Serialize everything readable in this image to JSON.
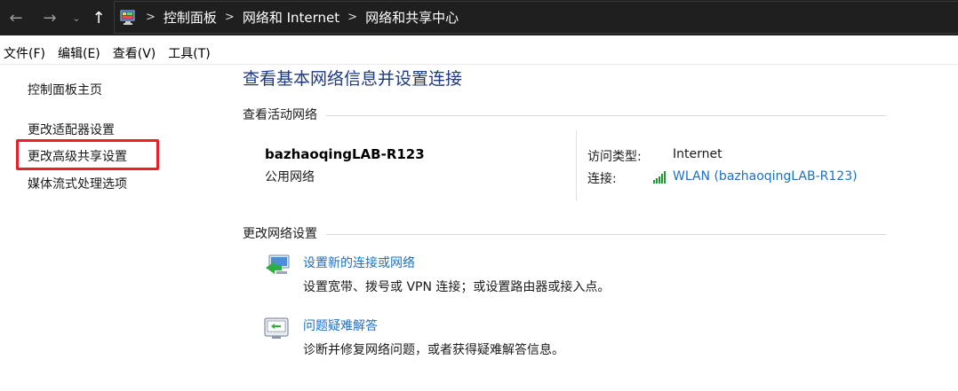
{
  "address_bar": {
    "back_glyph": "←",
    "forward_glyph": "→",
    "recent_glyph": "⌄",
    "up_glyph": "↑",
    "location_icon": "control-panel-icon",
    "separator": ">",
    "breadcrumbs": [
      "控制面板",
      "网络和 Internet",
      "网络和共享中心"
    ]
  },
  "menu": [
    "文件(F)",
    "编辑(E)",
    "查看(V)",
    "工具(T)"
  ],
  "left_nav": {
    "home": "控制面板主页",
    "items": [
      "更改适配器设置",
      "更改高级共享设置",
      "媒体流式处理选项"
    ],
    "highlighted_index": 1,
    "highlight_color": "#e8202a"
  },
  "main": {
    "title": "查看基本网络信息并设置连接",
    "active_networks": {
      "section_title": "查看活动网络",
      "network_name": "bazhaoqingLAB-R123",
      "network_kind": "公用网络",
      "access_type_label": "访问类型:",
      "access_type_value": "Internet",
      "connection_label": "连接:",
      "connection_icon": "wifi-signal-icon",
      "connection_value": "WLAN (bazhaoqingLAB-R123)"
    },
    "change_settings": {
      "section_title": "更改网络设置",
      "tasks": [
        {
          "icon": "new-connection-icon",
          "link": "设置新的连接或网络",
          "description": "设置宽带、拨号或 VPN 连接；或设置路由器或接入点。"
        },
        {
          "icon": "troubleshoot-icon",
          "link": "问题疑难解答",
          "description": "诊断并修复网络问题，或者获得疑难解答信息。"
        }
      ]
    }
  },
  "colors": {
    "title_blue": "#1e3a82",
    "link_blue": "#1e6fc6",
    "address_bar_bg": "#1f1f1f"
  }
}
